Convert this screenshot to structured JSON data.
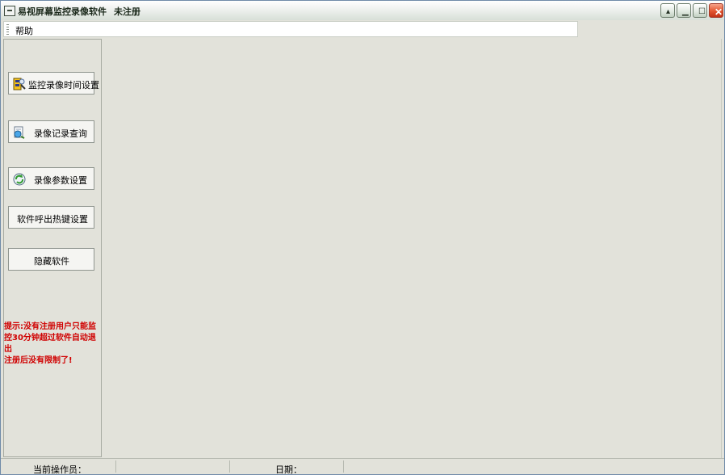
{
  "window": {
    "title": "易视屏幕监控录像软件",
    "status": "未注册"
  },
  "menu": {
    "help": "帮助"
  },
  "sidebar": {
    "buttons": [
      {
        "label": "监控录像时间设置",
        "icon": "clock-settings-icon"
      },
      {
        "label": "录像记录查询",
        "icon": "search-records-icon"
      },
      {
        "label": "录像参数设置",
        "icon": "refresh-params-icon"
      },
      {
        "label": "软件呼出热键设置"
      },
      {
        "label": "隐藏软件"
      }
    ],
    "hint": "提示:没有注册用户只能监\n控30分钟超过软件自动退出\n注册后没有限制了!"
  },
  "statusbar": {
    "operator_label": "当前操作员：",
    "date_label": "日期："
  },
  "colors": {
    "window_bg": "#e2e2da",
    "hint_red": "#d00000",
    "close_red": "#e3552f"
  }
}
